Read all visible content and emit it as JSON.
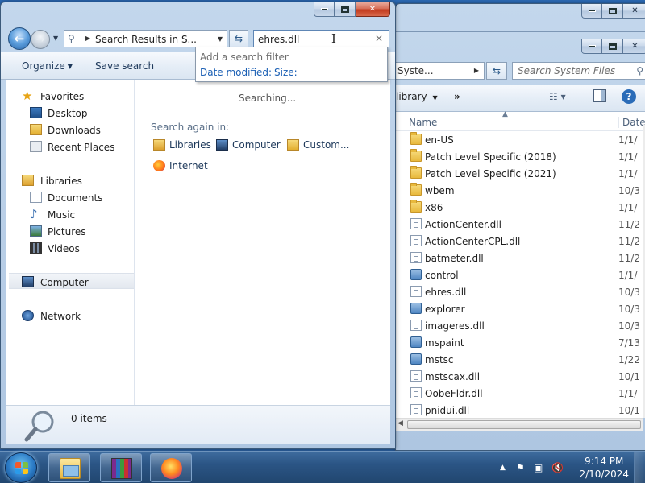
{
  "front_window": {
    "address_path": "Search Results in S...",
    "search_query": "ehres.dll",
    "toolbar": {
      "organize_label": "Organize",
      "save_search_label": "Save search"
    },
    "search_filter_dropdown": {
      "hint": "Add a search filter",
      "filters": [
        "Date modified:",
        "Size:"
      ]
    },
    "nav": {
      "favorites": {
        "label": "Favorites",
        "items": [
          "Desktop",
          "Downloads",
          "Recent Places"
        ]
      },
      "libraries": {
        "label": "Libraries",
        "items": [
          "Documents",
          "Music",
          "Pictures",
          "Videos"
        ]
      },
      "computer": "Computer",
      "network": "Network"
    },
    "results": {
      "status": "Searching...",
      "search_again_label": "Search again in:",
      "locations": [
        "Libraries",
        "Computer",
        "Custom...",
        "Internet"
      ]
    },
    "details": {
      "item_count": "0 items"
    }
  },
  "back_window": {
    "address_path": "Syste...",
    "search_placeholder": "Search System Files",
    "toolbar": {
      "library_label": "library",
      "more_label": "»"
    },
    "columns": {
      "name": "Name",
      "date": "Date"
    },
    "files": [
      {
        "name": "en-US",
        "date": "1/1/",
        "type": "folder"
      },
      {
        "name": "Patch Level Specific (2018)",
        "date": "1/1/",
        "type": "folder"
      },
      {
        "name": "Patch Level Specific (2021)",
        "date": "1/1/",
        "type": "folder"
      },
      {
        "name": "wbem",
        "date": "10/3",
        "type": "folder"
      },
      {
        "name": "x86",
        "date": "1/1/",
        "type": "folder"
      },
      {
        "name": "ActionCenter.dll",
        "date": "11/2",
        "type": "file"
      },
      {
        "name": "ActionCenterCPL.dll",
        "date": "11/2",
        "type": "file"
      },
      {
        "name": "batmeter.dll",
        "date": "11/2",
        "type": "file"
      },
      {
        "name": "control",
        "date": "1/1/",
        "type": "app"
      },
      {
        "name": "ehres.dll",
        "date": "10/3",
        "type": "file"
      },
      {
        "name": "explorer",
        "date": "10/3",
        "type": "app"
      },
      {
        "name": "imageres.dll",
        "date": "10/3",
        "type": "file"
      },
      {
        "name": "mspaint",
        "date": "7/13",
        "type": "app"
      },
      {
        "name": "mstsc",
        "date": "1/22",
        "type": "app"
      },
      {
        "name": "mstscax.dll",
        "date": "10/1",
        "type": "file"
      },
      {
        "name": "OobeFldr.dll",
        "date": "1/1/",
        "type": "file"
      },
      {
        "name": "pnidui.dll",
        "date": "10/1",
        "type": "file"
      }
    ]
  },
  "taskbar": {
    "time": "9:14 PM",
    "date": "2/10/2024",
    "pinned_apps": [
      "windows-explorer",
      "winrar",
      "firefox"
    ]
  }
}
